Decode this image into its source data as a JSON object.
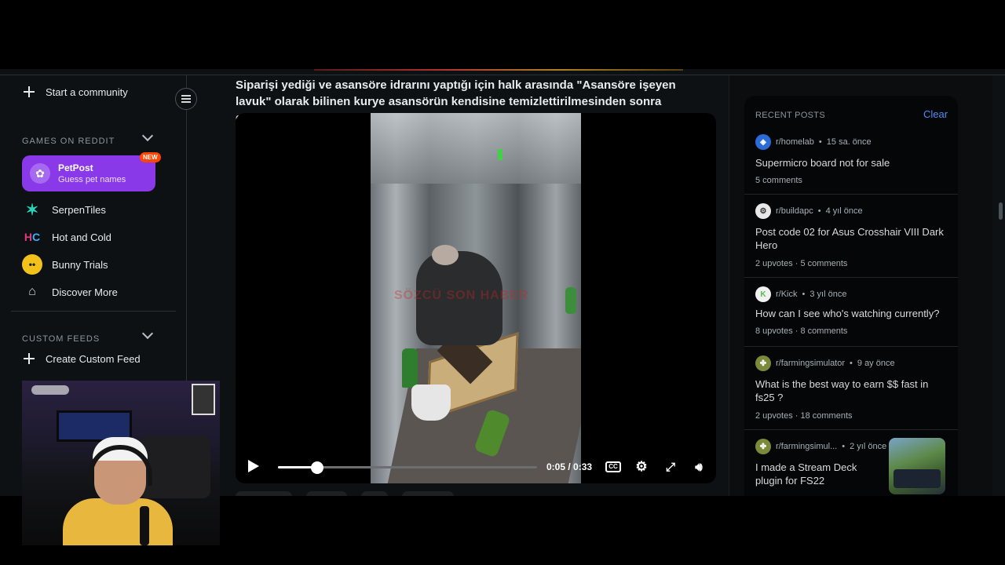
{
  "sidebar": {
    "start_community": "Start a community",
    "games_section": "GAMES ON REDDIT",
    "games": [
      {
        "name": "PetPost",
        "subtitle": "Guess pet names",
        "badge": "NEW"
      },
      {
        "name": "SerpenTiles"
      },
      {
        "name": "Hot and Cold"
      },
      {
        "name": "Bunny Trials"
      },
      {
        "name": "Discover More"
      }
    ],
    "custom_feeds_section": "CUSTOM FEEDS",
    "create_custom_feed": "Create Custom Feed"
  },
  "post": {
    "title": "Siparişi yediği ve asansöre idrarını yaptığı için halk arasında \"Asansöre işeyen lavuk\" olarak bilinen kurye asansörün kendisine temizlettirilmesinden sonra gözaltına alındı",
    "video": {
      "time": "0:05 / 0:33",
      "progress": 0.15,
      "watermark": "SÖZCÜ SON HABER"
    }
  },
  "recent_posts": {
    "heading": "RECENT POSTS",
    "clear_label": "Clear",
    "items": [
      {
        "community": "r/homelab",
        "age": "15 sa. önce",
        "title": "Supermicro board not for sale",
        "upvotes": "",
        "comments": "5 comments",
        "icon": "homelab-icon"
      },
      {
        "community": "r/buildapc",
        "age": "4 yıl önce",
        "title": "Post code 02 for Asus Crosshair VIII Dark Hero",
        "upvotes": "2 upvotes",
        "comments": "5 comments",
        "icon": "buildapc-icon"
      },
      {
        "community": "r/Kick",
        "age": "3 yıl önce",
        "title": "How can I see who's watching currently?",
        "upvotes": "8 upvotes",
        "comments": "8 comments",
        "icon": "kick-icon"
      },
      {
        "community": "r/farmingsimulator",
        "age": "9 ay önce",
        "title": "What is the best way to earn $$ fast in fs25 ?",
        "upvotes": "2 upvotes",
        "comments": "18 comments",
        "icon": "farmingsimulator-icon"
      },
      {
        "community": "r/farmingsimul...",
        "age": "2 yıl önce",
        "title": "I made a Stream Deck plugin for FS22",
        "upvotes": "",
        "comments": "",
        "icon": "farmingsimulator-icon"
      }
    ]
  },
  "colors": {
    "accent_purple": "#8a39e8",
    "badge_orange": "#ff4500",
    "link_blue": "#4f8cf7",
    "background": "#0e1113"
  }
}
